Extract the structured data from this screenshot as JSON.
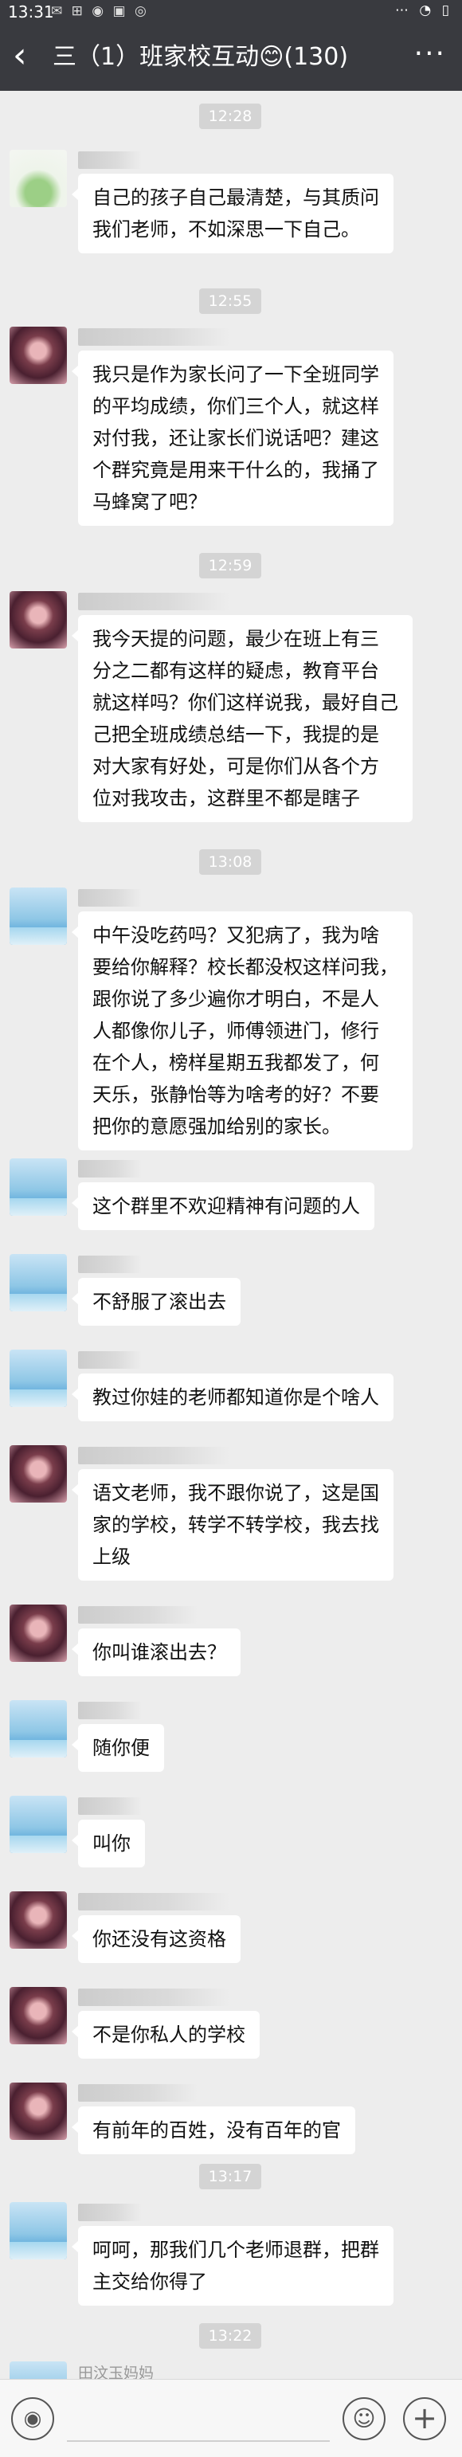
{
  "status_bar": {
    "time": "13:31",
    "notif_icons": "✉ ⊞ ◉ ▣ ◎",
    "right_icons": "⋯ ◔ ▯"
  },
  "header": {
    "back_glyph": "‹",
    "title": "三（1）班家校互动😊(130)",
    "more_glyph": "···"
  },
  "timestamps": [
    "12:28",
    "12:55",
    "12:59",
    "13:08",
    "13:17",
    "13:22"
  ],
  "messages": [
    {
      "lines": [
        "自己的孩子自己最清楚，与其质问",
        "我们老师，不如深思一下自己。"
      ]
    },
    {
      "lines": [
        "我只是作为家长问了一下全班同学",
        "的平均成绩，你们三个人，就这样",
        "对付我，还让家长们说话吧？建这",
        "个群究竟是用来干什么的，我捅了",
        "马蜂窝了吧？"
      ]
    },
    {
      "lines": [
        "我今天提的问题，最少在班上有三",
        "分之二都有这样的疑虑，教育平台",
        "就这样吗？你们这样说我，最好自己",
        "己把全班成绩总结一下，我提的是",
        "对大家有好处，可是你们从各个方",
        "位对我攻击，这群里不都是瞎子"
      ]
    },
    {
      "lines": [
        "中午没吃药吗？又犯病了，我为啥",
        "要给你解释？校长都没权这样问我，",
        "跟你说了多少遍你才明白，不是人",
        "人都像你儿子，师傅领进门，修行",
        "在个人，榜样星期五我都发了，何",
        "天乐，张静怡等为啥考的好？不要",
        "把你的意愿强加给别的家长。"
      ]
    },
    {
      "lines": [
        "这个群里不欢迎精神有问题的人"
      ]
    },
    {
      "lines": [
        "不舒服了滚出去"
      ]
    },
    {
      "lines": [
        "教过你娃的老师都知道你是个啥人"
      ]
    },
    {
      "lines": [
        "语文老师，我不跟你说了，这是国",
        "家的学校，转学不转学校，我去找",
        "上级"
      ]
    },
    {
      "lines": [
        "你叫谁滚出去？"
      ]
    },
    {
      "lines": [
        "随你便"
      ]
    },
    {
      "lines": [
        "叫你"
      ]
    },
    {
      "lines": [
        "你还没有这资格"
      ]
    },
    {
      "lines": [
        "不是你私人的学校"
      ]
    },
    {
      "lines": [
        "有前年的百姓，没有百年的官"
      ]
    },
    {
      "lines": [
        "呵呵，那我们几个老师退群，把群",
        "主交给你得了"
      ]
    }
  ],
  "last_sender": "田汶玉妈妈",
  "input_bar": {
    "voice_glyph": "◉",
    "emoji_glyph": "☺",
    "plus_glyph": "+"
  }
}
